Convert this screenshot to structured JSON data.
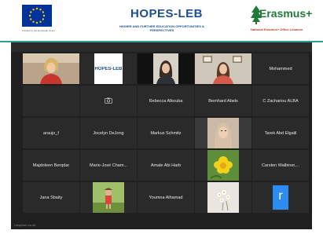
{
  "header": {
    "eu_caption": "Funded by the European Union",
    "hopes_title": "HOPES-LEB",
    "hopes_subtitle": "HIGHER AND FURTHER EDUCATION OPPORTUNITIES & PERSPECTIVES",
    "erasmus_title": "Erasmus+",
    "erasmus_subtitle": "National Erasmus+ Office Lebanon",
    "colors": {
      "eu_blue": "#003399",
      "eu_yellow": "#ffcc00",
      "hopes_blue": "#1f4e8f",
      "erasmus_green": "#1f7a3a",
      "erasmus_red": "#c0392b"
    }
  },
  "meeting": {
    "participants": [
      {
        "type": "video",
        "scene": "woman-blonde"
      },
      {
        "type": "logo",
        "label": "HOPES-LEB"
      },
      {
        "type": "video",
        "scene": "woman-dark-hair"
      },
      {
        "type": "video",
        "scene": "woman-room"
      },
      {
        "type": "name",
        "name": "Mohammed"
      },
      {
        "type": "empty"
      },
      {
        "type": "camera",
        "icon": "camera-icon"
      },
      {
        "type": "name",
        "name": "Rebecca Alkouba"
      },
      {
        "type": "name",
        "name": "Bernhard Abels"
      },
      {
        "type": "name",
        "name": "C Zachariou ALBA"
      },
      {
        "type": "name",
        "name": "araujo_f"
      },
      {
        "type": "name",
        "name": "Jocelyn DeJong"
      },
      {
        "type": "name",
        "name": "Markus Schmitz"
      },
      {
        "type": "video",
        "scene": "woman-headscarf"
      },
      {
        "type": "name",
        "name": "Tarek Abd Elgalil"
      },
      {
        "type": "name",
        "name": "Majdoleen Berqdar"
      },
      {
        "type": "name",
        "name": "Marie-José Cham..."
      },
      {
        "type": "name",
        "name": "Amale Abi Harb"
      },
      {
        "type": "image",
        "scene": "yellow-flower"
      },
      {
        "type": "name",
        "name": "Carsten Walbiner,..."
      },
      {
        "type": "name",
        "name": "Jana Sbaity"
      },
      {
        "type": "image",
        "scene": "child-outdoors"
      },
      {
        "type": "name",
        "name": "Youmna Alhamad"
      },
      {
        "type": "image",
        "scene": "white-flowers"
      },
      {
        "type": "avatar",
        "letter": "r"
      }
    ],
    "bottom_caption": "Unsplash.co.uk"
  }
}
